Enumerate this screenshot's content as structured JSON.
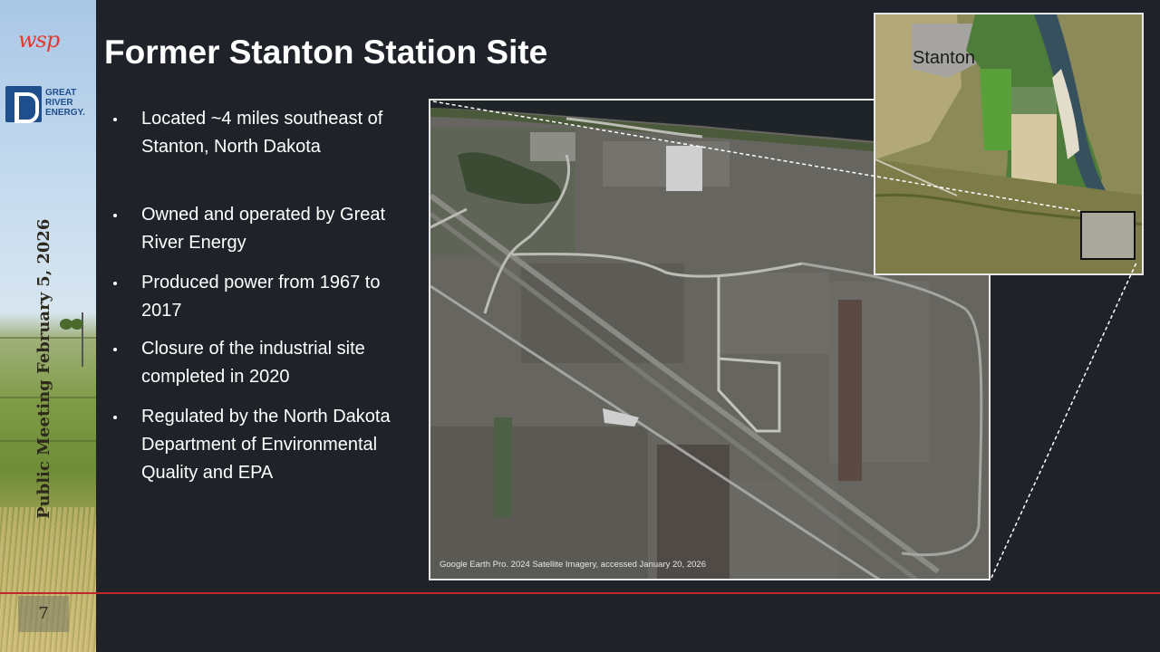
{
  "slide": {
    "title": "Former Stanton Station Site",
    "page_number": "7",
    "side_date": "Public Meeting February 5, 2026",
    "bullets": [
      "Located ~4 miles southeast of Stanton, North Dakota",
      "Owned and operated by Great River Energy",
      "Produced power from 1967 to 2017",
      "Closure of the industrial site completed in 2020",
      "Regulated by the North Dakota Department of Environmental Quality and EPA"
    ],
    "inset_label": "Stanton",
    "image_credit": "Google Earth Pro. 2024 Satellite Imagery, accessed January 20, 2026"
  },
  "logos": {
    "wsp": "wsp",
    "gre_lines": [
      "GREAT",
      "RIVER",
      "ENERGY."
    ]
  },
  "colors": {
    "background": "#1f2329",
    "accent_rule": "#c0282a",
    "wsp_red": "#e03a2f",
    "gre_blue": "#1f4e8c"
  }
}
